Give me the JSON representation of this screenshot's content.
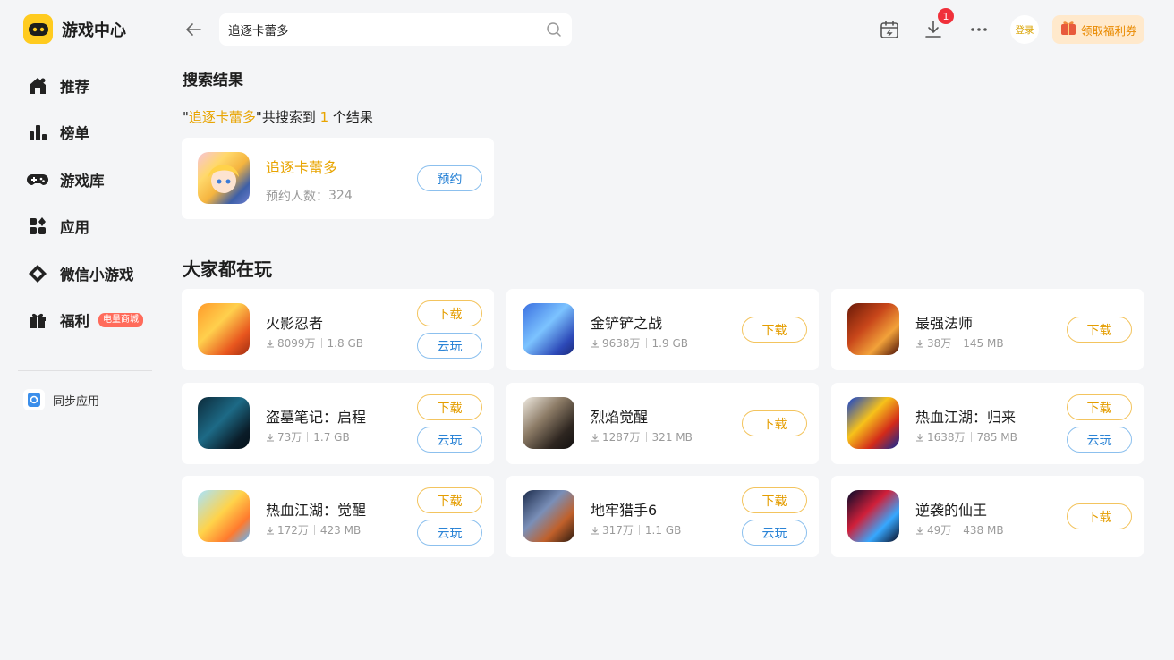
{
  "app": {
    "title": "游戏中心"
  },
  "sidebar": {
    "items": [
      {
        "label": "推荐",
        "icon": "home-icon"
      },
      {
        "label": "榜单",
        "icon": "ranking-icon"
      },
      {
        "label": "游戏库",
        "icon": "gamepad-icon"
      },
      {
        "label": "应用",
        "icon": "apps-icon"
      },
      {
        "label": "微信小游戏",
        "icon": "wechat-minigame-icon"
      },
      {
        "label": "福利",
        "icon": "gift-icon",
        "badge": "电量商城"
      }
    ],
    "sync_label": "同步应用"
  },
  "header": {
    "search_value": "追逐卡蕾多",
    "download_badge": "1",
    "login_label": "登录",
    "coupon_label": "领取福利券"
  },
  "results": {
    "title": "搜索结果",
    "summary": {
      "quote_open": "\"",
      "keyword": "追逐卡蕾多",
      "mid": "\"共搜索到 ",
      "count": "1",
      "tail": " 个结果"
    },
    "item": {
      "name": "追逐卡蕾多",
      "meta_label": "预约人数：",
      "meta_value": "324",
      "button": "预约"
    }
  },
  "popular": {
    "title": "大家都在玩",
    "download_label": "下载",
    "cloud_label": "云玩",
    "games": [
      {
        "name": "火影忍者",
        "downloads": "8099万",
        "size": "1.8 GB",
        "cloud": true
      },
      {
        "name": "金铲铲之战",
        "downloads": "9638万",
        "size": "1.9 GB",
        "cloud": false
      },
      {
        "name": "最强法师",
        "downloads": "38万",
        "size": "145 MB",
        "cloud": false
      },
      {
        "name": "盗墓笔记：启程",
        "downloads": "73万",
        "size": "1.7 GB",
        "cloud": true
      },
      {
        "name": "烈焰觉醒",
        "downloads": "1287万",
        "size": "321 MB",
        "cloud": false
      },
      {
        "name": "热血江湖：归来",
        "downloads": "1638万",
        "size": "785 MB",
        "cloud": true
      },
      {
        "name": "热血江湖：觉醒",
        "downloads": "172万",
        "size": "423 MB",
        "cloud": true
      },
      {
        "name": "地牢猎手6",
        "downloads": "317万",
        "size": "1.1 GB",
        "cloud": true
      },
      {
        "name": "逆袭的仙王",
        "downloads": "49万",
        "size": "438 MB",
        "cloud": false
      }
    ]
  },
  "colors": {
    "accent": "#e8a400",
    "brand_yellow": "#ffcb1f",
    "cloud_blue": "#2b84d6",
    "badge_red": "#f0303a"
  }
}
